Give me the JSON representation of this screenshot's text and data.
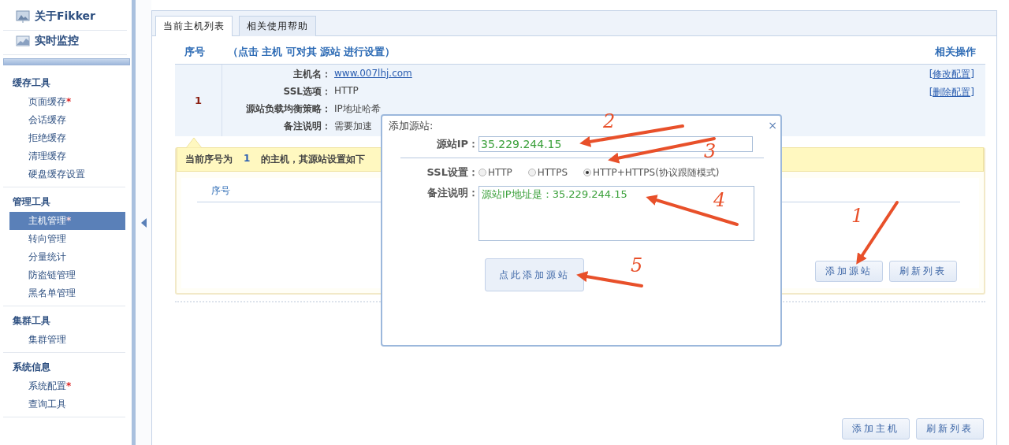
{
  "sidebar": {
    "top_links": [
      {
        "label": "关于Fikker",
        "kind": "about"
      },
      {
        "label": "实时监控",
        "kind": "monitor"
      }
    ],
    "groups": [
      {
        "title": "缓存工具",
        "items": [
          {
            "label": "页面缓存",
            "badge": "*",
            "selected": false
          },
          {
            "label": "会话缓存",
            "selected": false
          },
          {
            "label": "拒绝缓存",
            "selected": false
          },
          {
            "label": "清理缓存",
            "selected": false
          },
          {
            "label": "硬盘缓存设置",
            "selected": false
          }
        ]
      },
      {
        "title": "管理工具",
        "items": [
          {
            "label": "主机管理",
            "badge": "*",
            "selected": true
          },
          {
            "label": "转向管理",
            "selected": false
          },
          {
            "label": "分量统计",
            "selected": false
          },
          {
            "label": "防盗链管理",
            "selected": false
          },
          {
            "label": "黑名单管理",
            "selected": false
          }
        ]
      },
      {
        "title": "集群工具",
        "items": [
          {
            "label": "集群管理",
            "selected": false
          }
        ]
      },
      {
        "title": "系统信息",
        "items": [
          {
            "label": "系统配置",
            "badge": "*",
            "selected": false
          },
          {
            "label": "查询工具",
            "selected": false
          }
        ]
      }
    ]
  },
  "tabs": [
    {
      "label": "当前主机列表",
      "selected": true
    },
    {
      "label": "相关使用帮助",
      "selected": false
    }
  ],
  "host_table": {
    "columns": [
      "序号",
      "（点击 主机 可对其 源站 进行设置）",
      "相关操作"
    ],
    "rows": [
      {
        "index": "1",
        "fields": [
          {
            "label": "主机名：",
            "value": "www.007lhj.com",
            "kind": "link"
          },
          {
            "label": "SSL选项：",
            "value": "HTTP",
            "kind": "text"
          },
          {
            "label": "源站负载均衡策略：",
            "value": "IP地址哈希",
            "kind": "text"
          },
          {
            "label": "备注说明：",
            "value": "需要加速",
            "kind": "text"
          }
        ],
        "actions": [
          "[修改配置]",
          "[删除配置]"
        ]
      }
    ]
  },
  "origin_panel": {
    "notice_prefix": "当前序号为",
    "notice_index": "1",
    "notice_suffix": "的主机，其源站设置如下",
    "columns": [
      "序号"
    ],
    "buttons": [
      "添加源站",
      "刷新列表"
    ]
  },
  "buttons": [
    "添加主机",
    "刷新列表"
  ],
  "dialog": {
    "title": "添加源站:",
    "close": "×",
    "ip_label": "源站IP：",
    "ip_value": "35.229.244.15",
    "ssl_label": "SSL设置：",
    "ssl_options": [
      {
        "label": "HTTP",
        "selected": false
      },
      {
        "label": "HTTPS",
        "selected": false
      },
      {
        "label": "HTTP+HTTPS(协议跟随模式)",
        "selected": true
      }
    ],
    "note_label": "备注说明：",
    "note_value": "源站IP地址是：35.229.244.15",
    "submit": "点此添加源站"
  },
  "annotations": [
    {
      "label": "1"
    },
    {
      "label": "2"
    },
    {
      "label": "3"
    },
    {
      "label": "4"
    },
    {
      "label": "5"
    }
  ]
}
